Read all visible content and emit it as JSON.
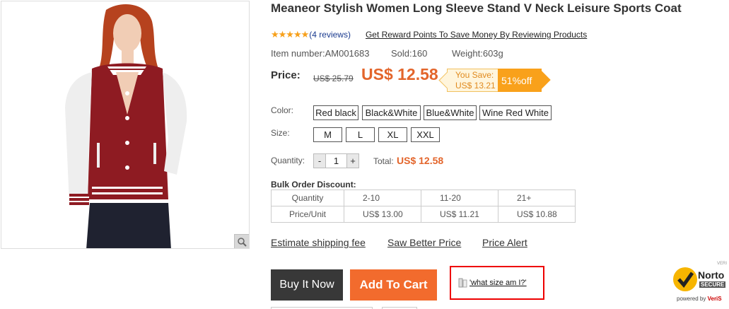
{
  "product": {
    "title": "Meaneor Stylish Women Long Sleeve Stand V Neck Leisure Sports Coat",
    "stars": "★★★★★",
    "reviews": "(4 reviews)",
    "reward_link": "Get Reward Points To Save Money By Reviewing Products",
    "item_number": "Item number:AM001683",
    "sold": "Sold:160",
    "weight": "Weight:603g"
  },
  "price": {
    "label": "Price:",
    "old": "US$ 25.79",
    "new": "US$ 12.58",
    "save_label": "You Save:",
    "save_amount": "US$ 13.21",
    "discount": "51%off"
  },
  "options": {
    "color_label": "Color:",
    "colors": [
      "Red black",
      "Black&White",
      "Blue&White",
      "Wine Red White"
    ],
    "size_label": "Size:",
    "sizes": [
      "M",
      "L",
      "XL",
      "XXL"
    ]
  },
  "quantity": {
    "label": "Quantity:",
    "minus": "-",
    "value": "1",
    "plus": "+",
    "total_label": "Total:",
    "total_value": "US$ 12.58"
  },
  "bulk": {
    "title": "Bulk Order Discount:",
    "rows": [
      [
        "Quantity",
        "2-10",
        "11-20",
        "21+"
      ],
      [
        "Price/Unit",
        "US$ 13.00",
        "US$ 11.21",
        "US$ 10.88"
      ]
    ]
  },
  "links": {
    "shipping": "Estimate shipping fee",
    "better_price": "Saw Better Price",
    "alert": "Price Alert"
  },
  "actions": {
    "buy": "Buy It Now",
    "cart": "Add To Cart",
    "size_help": "'what size am I?'"
  },
  "norton": {
    "small": "VERI",
    "name": "Norto",
    "sub": "SECURE",
    "powered_by": "powered by ",
    "brand": "VeriS"
  },
  "colors": {
    "accent": "#f26b2d",
    "price": "#e3652b",
    "buy_bg": "#383838",
    "badge": "#f9a11b",
    "highlight_border": "#ee0000"
  }
}
